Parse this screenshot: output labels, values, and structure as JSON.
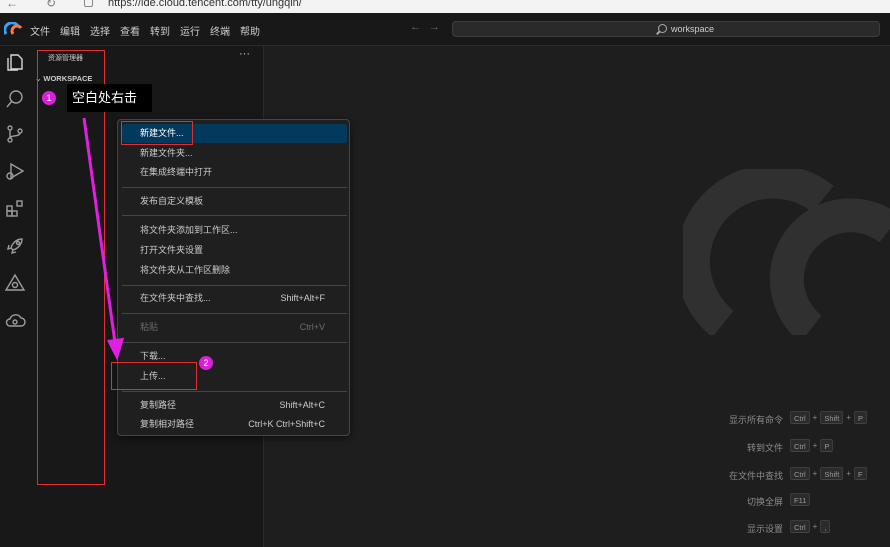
{
  "browser": {
    "url": "https://ide.cloud.tencent.com/tty/ungqin/"
  },
  "menubar": [
    "文件",
    "编辑",
    "选择",
    "查看",
    "转到",
    "运行",
    "终端",
    "帮助"
  ],
  "search": {
    "placeholder": "workspace"
  },
  "sidebar": {
    "title": "资源管理器",
    "more": "···",
    "workspace": "WORKSPACE"
  },
  "annotations": {
    "step1_number": "1",
    "step1_text": "空白处右击",
    "step2_number": "2",
    "highlight_color": "#e03030",
    "arrow_color": "#e020e0"
  },
  "context_menu": {
    "items": [
      {
        "label": "新建文件...",
        "shortcut": "",
        "state": "selected"
      },
      {
        "label": "新建文件夹...",
        "shortcut": "",
        "state": "normal"
      },
      {
        "label": "在集成终端中打开",
        "shortcut": "",
        "state": "normal"
      },
      {
        "label": "发布自定义模板",
        "shortcut": "",
        "state": "normal"
      },
      {
        "label": "将文件夹添加到工作区...",
        "shortcut": "",
        "state": "normal"
      },
      {
        "label": "打开文件夹设置",
        "shortcut": "",
        "state": "normal"
      },
      {
        "label": "将文件夹从工作区删除",
        "shortcut": "",
        "state": "normal"
      },
      {
        "label": "在文件夹中查找...",
        "shortcut": "Shift+Alt+F",
        "state": "normal"
      },
      {
        "label": "粘贴",
        "shortcut": "Ctrl+V",
        "state": "disabled"
      },
      {
        "label": "下载...",
        "shortcut": "",
        "state": "normal"
      },
      {
        "label": "上传...",
        "shortcut": "",
        "state": "normal"
      },
      {
        "label": "复制路径",
        "shortcut": "Shift+Alt+C",
        "state": "normal"
      },
      {
        "label": "复制相对路径",
        "shortcut": "Ctrl+K Ctrl+Shift+C",
        "state": "normal"
      }
    ]
  },
  "shortcuts": [
    {
      "label": "显示所有命令",
      "keys": [
        "Ctrl",
        "Shift",
        "P"
      ]
    },
    {
      "label": "转到文件",
      "keys": [
        "Ctrl",
        "P"
      ]
    },
    {
      "label": "在文件中查找",
      "keys": [
        "Ctrl",
        "Shift",
        "F"
      ]
    },
    {
      "label": "切换全屏",
      "keys": [
        "F11"
      ]
    },
    {
      "label": "显示设置",
      "keys": [
        "Ctrl",
        ","
      ]
    }
  ],
  "activity_icons": [
    "files-icon",
    "search-icon",
    "source-control-icon",
    "run-debug-icon",
    "extensions-icon",
    "rocket-icon",
    "triangle-icon",
    "cloud-icon"
  ]
}
